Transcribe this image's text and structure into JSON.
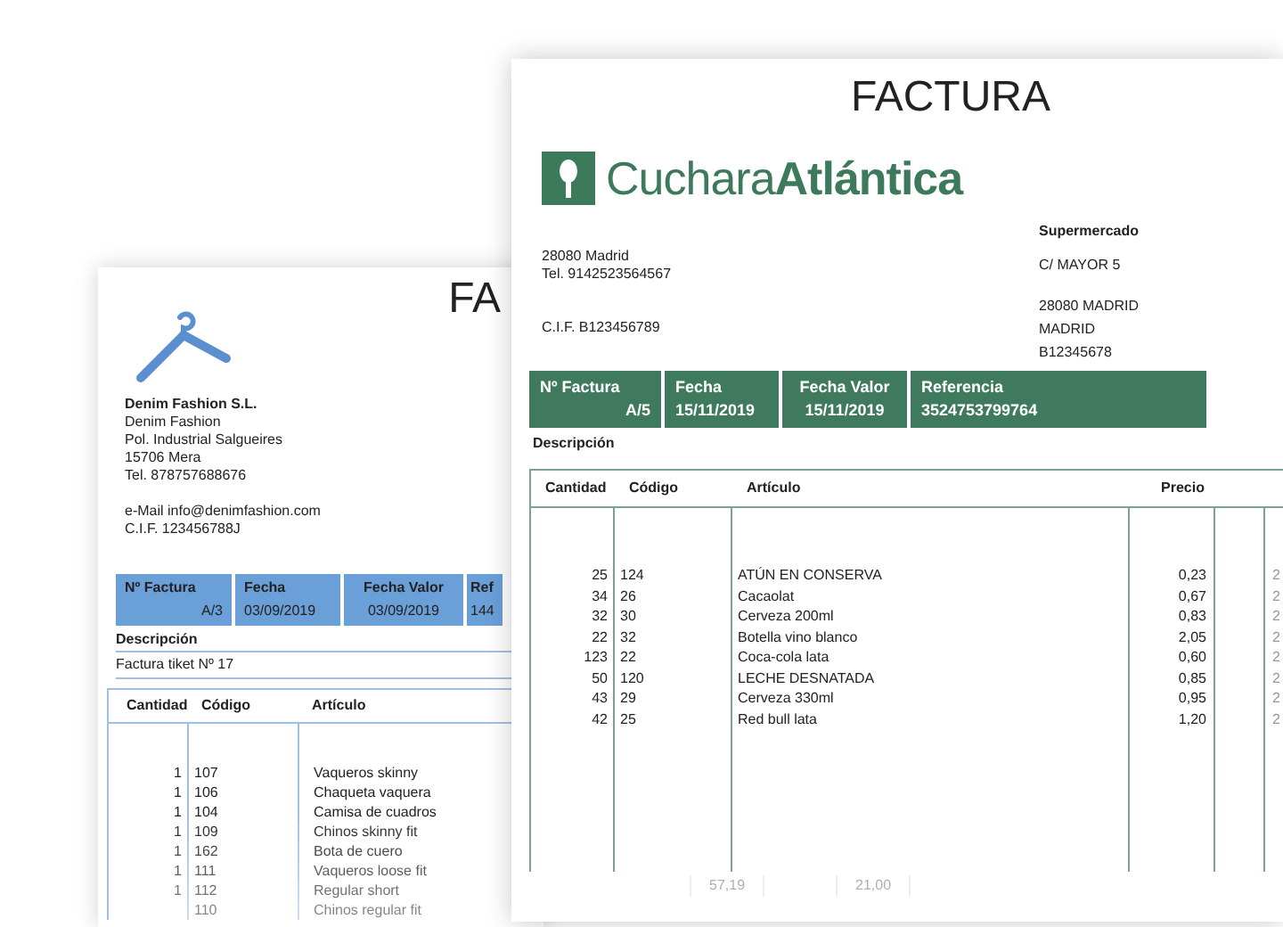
{
  "back_invoice": {
    "title": "FA",
    "company_name": "Denim Fashion S.L.",
    "address_lines": [
      "Denim Fashion",
      "Pol. Industrial Salgueires",
      "15706 Mera",
      "Tel. 878757688676"
    ],
    "contact_lines": [
      "e-Mail info@denimfashion.com",
      "C.I.F. 123456788J"
    ],
    "header": [
      {
        "label": "Nº Factura",
        "value": "A/3"
      },
      {
        "label": "Fecha",
        "value": "03/09/2019"
      },
      {
        "label": "Fecha Valor",
        "value": "03/09/2019"
      },
      {
        "label": "Ref",
        "value": "144"
      }
    ],
    "description_label": "Descripción",
    "description": "Factura tiket Nº 17",
    "columns": [
      "Cantidad",
      "Código",
      "Artículo"
    ],
    "rows": [
      {
        "qty": "1",
        "code": "107",
        "item": "Vaqueros skinny"
      },
      {
        "qty": "1",
        "code": "106",
        "item": "Chaqueta vaquera"
      },
      {
        "qty": "1",
        "code": "104",
        "item": "Camisa de cuadros"
      },
      {
        "qty": "1",
        "code": "109",
        "item": "Chinos skinny fit"
      },
      {
        "qty": "1",
        "code": "162",
        "item": "Bota de cuero"
      },
      {
        "qty": "1",
        "code": "111",
        "item": "Vaqueros loose fit"
      },
      {
        "qty": "1",
        "code": "112",
        "item": "Regular short"
      },
      {
        "qty": "",
        "code": "110",
        "item": "Chinos regular fit"
      }
    ]
  },
  "front_invoice": {
    "title": "FACTURA",
    "logo": {
      "light": "Cuchara",
      "bold": "Atlántica"
    },
    "seller_lines": [
      "28080 Madrid",
      "Tel. 9142523564567"
    ],
    "seller_cif": "C.I.F. B123456789",
    "client_name": "Supermercado",
    "client_street": "C/ MAYOR 5",
    "client_lines": [
      "28080 MADRID",
      "MADRID",
      "B12345678"
    ],
    "header": [
      {
        "label": "Nº Factura",
        "value": "A/5"
      },
      {
        "label": "Fecha",
        "value": "15/11/2019"
      },
      {
        "label": "Fecha Valor",
        "value": "15/11/2019"
      },
      {
        "label": "Referencia",
        "value": "3524753799764"
      }
    ],
    "description_label": "Descripción",
    "columns": [
      "Cantidad",
      "Código",
      "Artículo",
      "Precio"
    ],
    "rows": [
      {
        "qty": "25",
        "code": "124",
        "item": "ATÚN EN CONSERVA",
        "price": "0,23",
        "column_5": "2"
      },
      {
        "qty": "34",
        "code": "26",
        "item": "Cacaolat",
        "price": "0,67",
        "column_5": "2"
      },
      {
        "qty": "32",
        "code": "30",
        "item": "Cerveza 200ml",
        "price": "0,83",
        "column_5": "2"
      },
      {
        "qty": "22",
        "code": "32",
        "item": "Botella vino blanco",
        "price": "2,05",
        "column_5": "2"
      },
      {
        "qty": "123",
        "code": "22",
        "item": "Coca-cola lata",
        "price": "0,60",
        "column_5": "2"
      },
      {
        "qty": "50",
        "code": "120",
        "item": "LECHE DESNATADA",
        "price": "0,85",
        "column_5": "2"
      },
      {
        "qty": "43",
        "code": "29",
        "item": "Cerveza 330ml",
        "price": "0,95",
        "column_5": "2"
      },
      {
        "qty": "42",
        "code": "25",
        "item": "Red bull lata",
        "price": "1,20",
        "column_5": "2"
      }
    ],
    "totals": [
      "57,19",
      "21,00"
    ]
  }
}
